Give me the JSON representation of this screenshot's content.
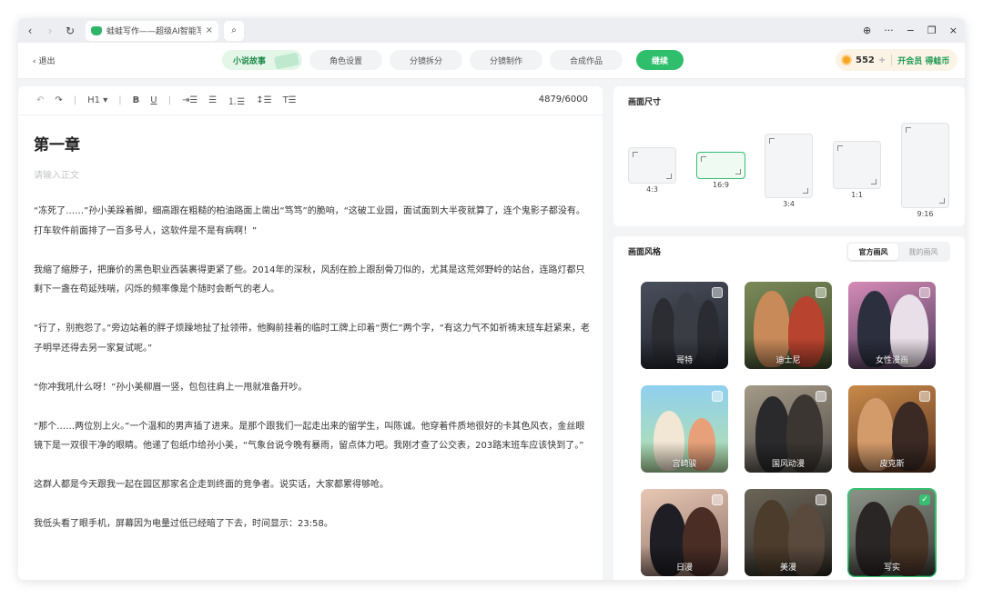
{
  "browser": {
    "tab_title": "蛙蛙写作——超级AI智能写作",
    "back": "‹",
    "forward": "›",
    "reload": "↻",
    "tab_close": "×",
    "search": "⌕",
    "globe": "⊕",
    "more": "···",
    "minimize": "−",
    "restore": "❐",
    "close": "×"
  },
  "toolbar": {
    "exit_label": "退出",
    "steps": [
      "小说故事",
      "角色设置",
      "分镜拆分",
      "分镜制作",
      "合成作品"
    ],
    "continue_label": "继续",
    "coin_count": "552",
    "coin_plus": "+",
    "vip_label": "开会员 得蛙币"
  },
  "editor": {
    "undo": "↶",
    "redo": "↷",
    "heading": "H1",
    "bold": "B",
    "underline": "U",
    "indent": "⇥☰",
    "bullet": "☰",
    "numbered": "⒈☰",
    "line_height": "↕☰",
    "clear": "T☰",
    "word_count": "4879/6000",
    "chapter_title": "第一章",
    "placeholder": "请输入正文",
    "paragraphs": [
      "“冻死了……”孙小美跺着脚，细高跟在粗糙的柏油路面上凿出“笃笃”的脆响，“这破工业园，面试面到大半夜就算了，连个鬼影子都没有。打车软件前面排了一百多号人，这软件是不是有病啊！”",
      "我缩了缩脖子，把廉价的黑色职业西装裹得更紧了些。2014年的深秋，风刮在脸上跟刮骨刀似的，尤其是这荒郊野岭的站台，连路灯都只剩下一盏在苟延残喘，闪烁的频率像是个随时会断气的老人。",
      "“行了，别抱怨了。”旁边站着的胖子烦躁地扯了扯领带，他胸前挂着的临时工牌上印着“贾仁”两个字，“有这力气不如祈祷末班车赶紧来，老子明早还得去另一家复试呢。”",
      "“你冲我吼什么呀！”孙小美柳眉一竖，包包往肩上一甩就准备开吵。",
      "“那个……两位別上火。”一个温和的男声插了进来。是那个跟我们一起走出来的留学生，叫陈诚。他穿着件质地很好的卡其色风衣，金丝眼镜下是一双很干净的眼睛。他递了包纸巾给孙小美，“气象台说今晚有暴雨，留点体力吧。我刚才查了公交表，203路末班车应该快到了。”",
      "这群人都是今天跟我一起在园区那家名企走到终面的竞争者。说实话，大家都累得够呛。",
      "我低头看了眼手机，屏幕因为电量过低已经暗了下去，时间显示：23:58。"
    ]
  },
  "size_panel": {
    "title": "画面尺寸",
    "ratios": [
      "4:3",
      "16:9",
      "3:4",
      "1:1",
      "9:16"
    ],
    "selected": "16:9"
  },
  "style_panel": {
    "title": "画面风格",
    "tabs": [
      "官方画风",
      "我的画风"
    ],
    "styles": [
      "哥特",
      "迪士尼",
      "女性漫画",
      "宫崎骏",
      "国风动漫",
      "皮克斯",
      "日漫",
      "美漫",
      "写实"
    ],
    "selected": "写实",
    "check_mark": "✓"
  }
}
